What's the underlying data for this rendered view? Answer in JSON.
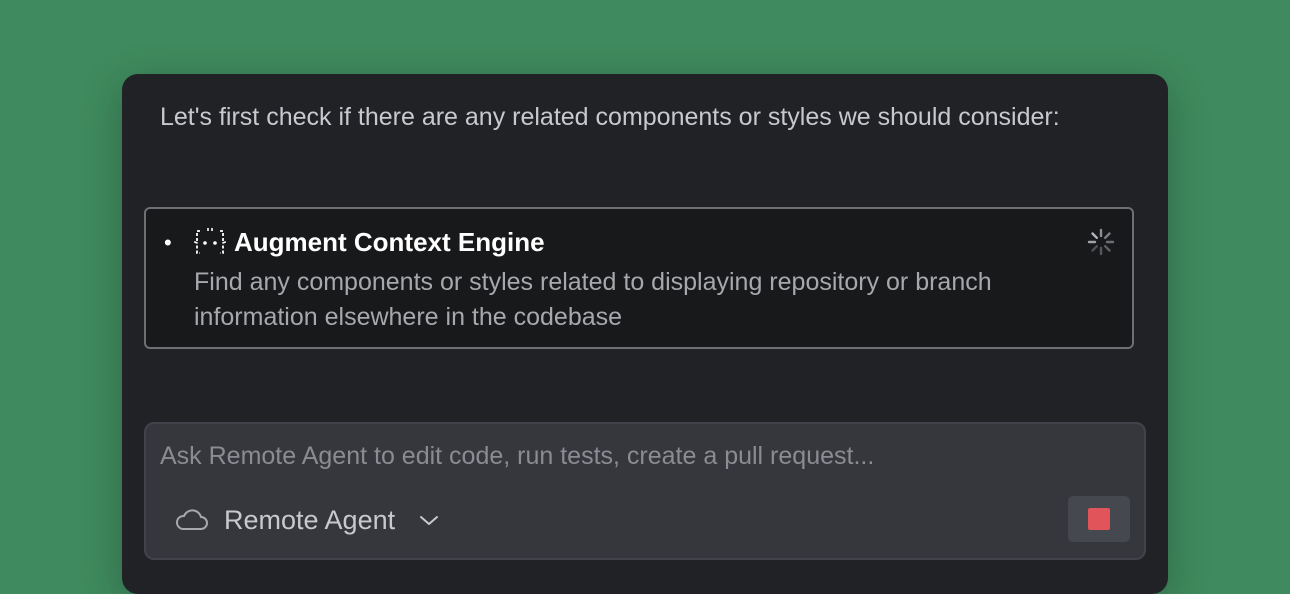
{
  "message": {
    "intro_text": "Let's first check if there are any related components or styles we should consider:"
  },
  "tool_call": {
    "bullet": "•",
    "icon": "context-engine-icon",
    "title": "Augment Context Engine",
    "description": "Find any components or styles related to displaying repository or branch information elsewhere in the codebase",
    "status_icon": "loading-spinner-icon"
  },
  "composer": {
    "placeholder": "Ask Remote Agent to edit code, run tests, create a pull request...",
    "value": "",
    "mode_icon": "cloud-icon",
    "mode_label": "Remote Agent",
    "mode_chevron_icon": "chevron-down-icon",
    "stop_icon": "stop-icon"
  },
  "colors": {
    "background": "#3f8a5e",
    "panel": "#212226",
    "card": "#18191b",
    "card_border": "#6d6f74",
    "input_bg": "#35373d",
    "stop_red": "#e0545a"
  }
}
